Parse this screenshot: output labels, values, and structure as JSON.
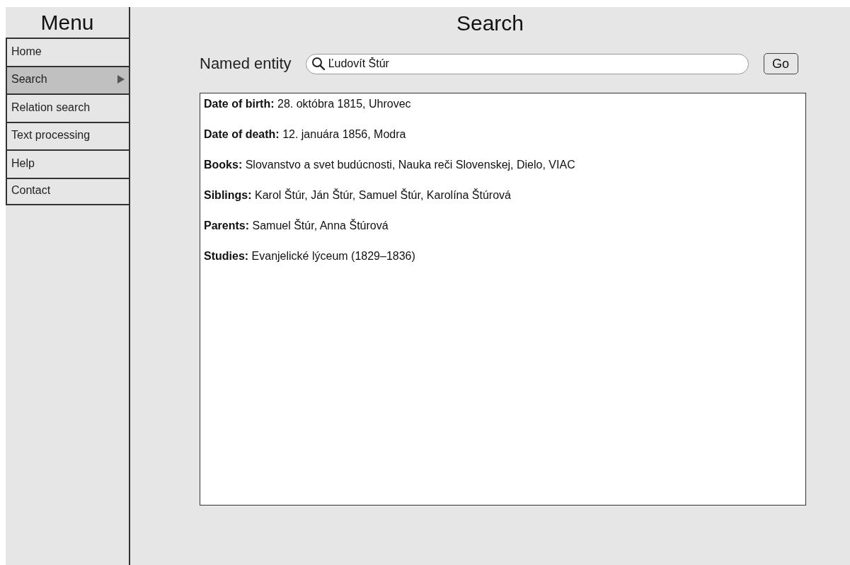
{
  "sidebar": {
    "title": "Menu",
    "items": [
      {
        "label": "Home",
        "selected": false
      },
      {
        "label": "Search",
        "selected": true
      },
      {
        "label": "Relation search",
        "selected": false
      },
      {
        "label": "Text processing",
        "selected": false
      },
      {
        "label": "Help",
        "selected": false
      },
      {
        "label": "Contact",
        "selected": false
      }
    ]
  },
  "main": {
    "title": "Search",
    "search": {
      "label": "Named entity",
      "value": "Ľudovít Štúr",
      "button": "Go"
    },
    "results": [
      {
        "label": "Date of birth:",
        "value": "28. októbra 1815, Uhrovec"
      },
      {
        "label": "Date of death:",
        "value": "12. januára 1856, Modra"
      },
      {
        "label": "Books:",
        "value": "Slovanstvo a svet budúcnosti, Nauka reči Slovenskej, Dielo, VIAC"
      },
      {
        "label": "Siblings:",
        "value": "Karol Štúr, Ján Štúr, Samuel Štúr, Karolína Štúrová"
      },
      {
        "label": "Parents:",
        "value": "Samuel Štúr, Anna Štúrová"
      },
      {
        "label": "Studies:",
        "value": "Evanjelické lýceum (1829–1836)"
      }
    ]
  }
}
